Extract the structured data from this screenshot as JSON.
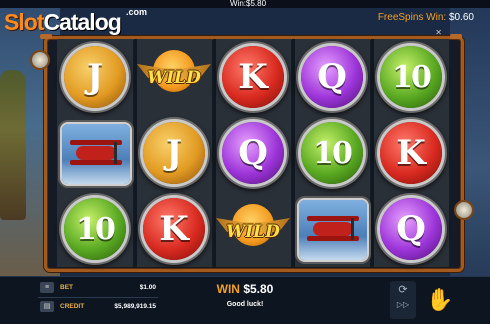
{
  "top_bar": {
    "win_text": "Win:$5.80"
  },
  "logo": {
    "slot": "Slot",
    "catalog": "Catalog",
    "dotcom": ".com"
  },
  "freespins": {
    "label": "FreeSpins Win:",
    "value": "$0.60"
  },
  "close_glyph": "✕",
  "reels": [
    [
      "J",
      "plane",
      "10"
    ],
    [
      "WILD",
      "J",
      "K"
    ],
    [
      "K",
      "Q",
      "WILD"
    ],
    [
      "Q",
      "10",
      "plane"
    ],
    [
      "10",
      "K",
      "Q"
    ]
  ],
  "wild_label": "WILD",
  "symbol_colors": {
    "J": "#e29b23",
    "K": "#d92a20",
    "Q": "#9d35d9",
    "10": "#5aa922"
  },
  "bottom": {
    "bet_label": "BET",
    "bet_value": "$1.00",
    "credit_label": "CREDIT",
    "credit_value": "$5,989,919.15",
    "win_label": "WIN",
    "win_value": "$5.80",
    "message": "Good luck!",
    "stack_icon": "≡",
    "wallet_icon": "▤",
    "spin_icon": "⟳",
    "fast_icon": "▷▷",
    "cashout_icon": "✋"
  }
}
